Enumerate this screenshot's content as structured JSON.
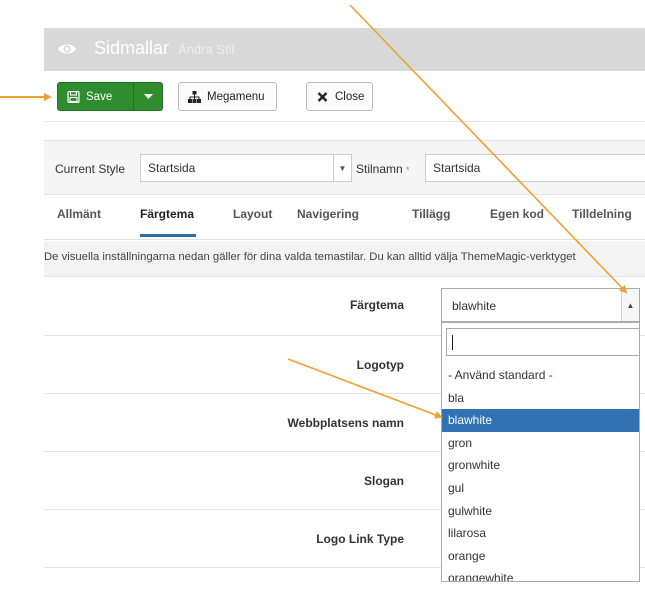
{
  "header": {
    "title": "Sidmallar",
    "subtitle": "Ändra Stil"
  },
  "toolbar": {
    "save_label": "Save",
    "megamenu_label": "Megamenu",
    "close_label": "Close"
  },
  "style_bar": {
    "current_style_label": "Current Style",
    "current_style_value": "Startsida",
    "stilnamn_label": "Stilnamn",
    "required_mark": "*",
    "stilnamn_value": "Startsida"
  },
  "tabs": [
    {
      "label": "Allmänt",
      "active": false
    },
    {
      "label": "Färgtema",
      "active": true
    },
    {
      "label": "Layout",
      "active": false
    },
    {
      "label": "Navigering",
      "active": false
    },
    {
      "label": "Tillägg",
      "active": false
    },
    {
      "label": "Egen kod",
      "active": false
    },
    {
      "label": "Tilldelning",
      "active": false
    }
  ],
  "info_text": "De visuella inställningarna nedan gäller för dina valda temastilar. Du kan alltid välja ThemeMagic-verktyget",
  "rows": [
    {
      "label": "Färgtema"
    },
    {
      "label": "Logotyp"
    },
    {
      "label": "Webbplatsens namn"
    },
    {
      "label": "Slogan"
    },
    {
      "label": "Logo Link Type"
    }
  ],
  "color_select": {
    "value": "blawhite",
    "search_value": "",
    "options": [
      "- Använd standard -",
      "bla",
      "blawhite",
      "gron",
      "gronwhite",
      "gul",
      "gulwhite",
      "lilarosa",
      "orange",
      "orangewhite"
    ],
    "highlighted": "blawhite"
  },
  "colors": {
    "header_bg": "#d8d8d8",
    "save_green": "#2f8d2f",
    "tab_underline": "#2a6fa8",
    "highlight_blue": "#3072b3",
    "annotation_orange": "#f0a030"
  },
  "icons": {
    "eye": "eye-icon",
    "save": "floppy-disk-icon",
    "megamenu": "sitemap-icon",
    "close": "close-icon"
  }
}
